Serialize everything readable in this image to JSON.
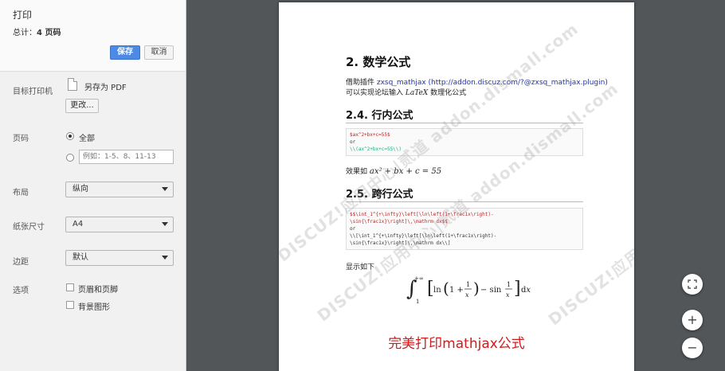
{
  "panel": {
    "title": "打印",
    "total_prefix": "总计：",
    "total_value": "4 页码",
    "save_label": "保存",
    "cancel_label": "取消",
    "destination": {
      "label": "目标打印机",
      "value": "另存为 PDF",
      "change_label": "更改..."
    },
    "pages": {
      "label": "页码",
      "all_label": "全部",
      "custom_placeholder": "例如：1-5、8、11-13",
      "selected": "all"
    },
    "layout": {
      "label": "布局",
      "value": "纵向"
    },
    "paper": {
      "label": "纸张尺寸",
      "value": "A4"
    },
    "margins": {
      "label": "边距",
      "value": "默认"
    },
    "options": {
      "label": "选项",
      "items": [
        "页眉和页脚",
        "背景图形"
      ]
    }
  },
  "preview": {
    "h_math": "2. 数学公式",
    "intro_prefix": "借助插件 ",
    "intro_link": "zxsq_mathjax (http://addon.discuz.com/?@zxsq_mathjax.plugin)",
    "intro_line2_prefix": "可以实现论坛输入 ",
    "intro_latex": "LaTeX",
    "intro_line2_suffix": " 数理化公式",
    "h_inline": "2.4. 行内公式",
    "code_inline": [
      "$ax^2+bx+c=55$",
      "or",
      "\\\\(ax^2+bx+c=55\\\\)"
    ],
    "inline_effect_prefix": "效果如 ",
    "inline_formula": "ax² + bx + c = 55",
    "h_display": "2.5. 跨行公式",
    "code_display": [
      "$$\\int_1^{+\\infty}\\left[\\ln\\left(1+\\frac1x\\right)-",
      "\\sin{\\frac1x}\\right]\\,\\mathrm dx$$",
      "or",
      "\\\\[\\int_1^{+\\infty}\\left[\\ln\\left(1+\\frac1x\\right)-",
      "\\sin{\\frac1x}\\right]\\,\\mathrm dx\\\\]"
    ],
    "display_caption": "显示如下",
    "caption": "完美打印mathjax公式",
    "watermark": "DISCUZ!应用中心|贰道 addon.dismall.com"
  },
  "zoom": {
    "fit_icon": "fit-to-page-icon",
    "in_label": "+",
    "out_label": "−"
  },
  "colors": {
    "save": "#4d8ae8",
    "viewer_bg": "#525659",
    "caption": "#d41a1a"
  }
}
